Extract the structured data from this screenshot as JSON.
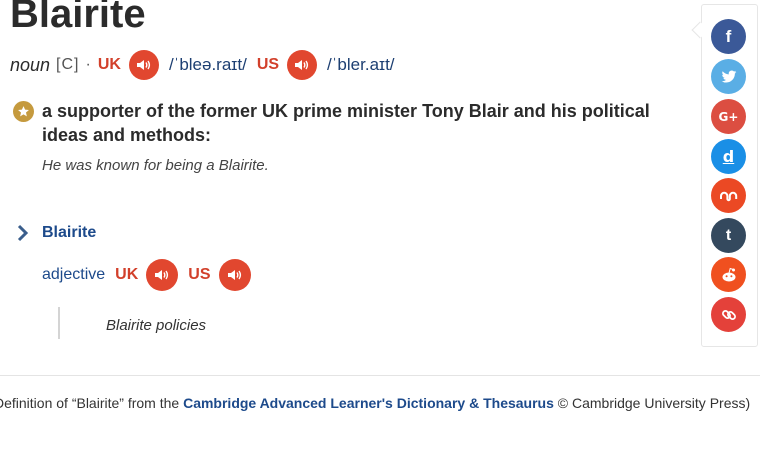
{
  "entry": {
    "headword": "Blairite",
    "pos": "noun",
    "grammar": "[C]",
    "separator": "·",
    "uk_label": "UK",
    "uk_ipa": "/ˈbleə.raɪt/",
    "us_label": "US",
    "us_ipa": "/ˈbler.aɪt/",
    "definition": "a supporter of the former UK prime minister Tony Blair and his political ideas and methods:",
    "example": "He was known for being a Blairite.",
    "icon": "star-icon"
  },
  "related": {
    "word": "Blairite",
    "pos": "adjective",
    "uk_label": "UK",
    "us_label": "US",
    "example": "Blairite policies"
  },
  "source": {
    "prefix": "Definition of “Blairite” from the ",
    "link_text": "Cambridge Advanced Learner's Dictionary & Thesaurus",
    "suffix": " © Cambridge University Press)"
  },
  "share": {
    "buttons": [
      {
        "icon": "facebook-icon",
        "glyph": "f",
        "color": "#3b5998"
      },
      {
        "icon": "twitter-icon",
        "glyph": "",
        "color": "#5aaee5"
      },
      {
        "icon": "google-plus-icon",
        "glyph": "G+",
        "color": "#dc4e41"
      },
      {
        "icon": "delicious-icon",
        "glyph": "d",
        "color": "#1a8fe6"
      },
      {
        "icon": "stumbleupon-icon",
        "glyph": "",
        "color": "#eb4924"
      },
      {
        "icon": "tumblr-icon",
        "glyph": "t",
        "color": "#34495e"
      },
      {
        "icon": "reddit-icon",
        "glyph": "",
        "color": "#f0501f"
      },
      {
        "icon": "link-icon",
        "glyph": "",
        "color": "#e4413a"
      }
    ]
  },
  "colors": {
    "headword": "#2b2b2b",
    "region_label": "#d2402b",
    "audio_button": "#e1472f",
    "link_blue": "#1d4a8b",
    "definition_icon": "#c59a3e"
  }
}
